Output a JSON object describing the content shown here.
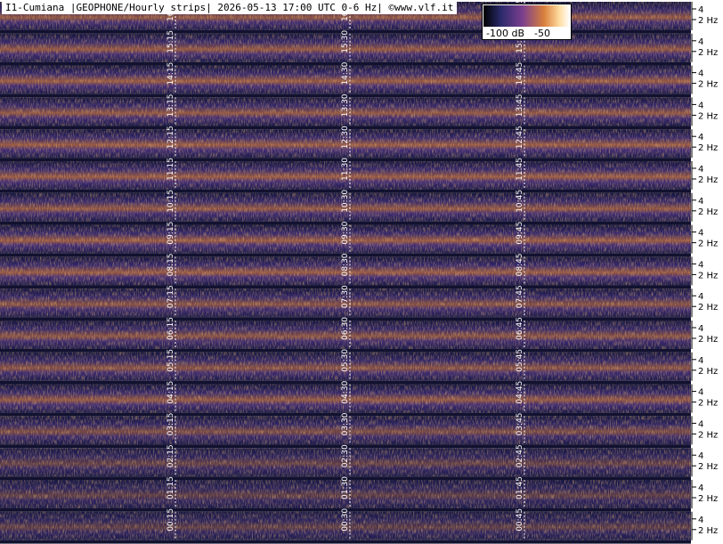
{
  "header": {
    "title": "I1-Cumiana |GEOPHONE/Hourly strips| 2026-05-13 17:00 UTC 0-6 Hz| ©www.vlf.it"
  },
  "colorbar": {
    "label_low": "-100 dB",
    "label_high": "-50"
  },
  "chart_data": {
    "type": "heatmap",
    "title": "I1-Cumiana |GEOPHONE/Hourly strips| 2026-05-13 17:00 UTC 0-6 Hz| ©www.vlf.it",
    "xlabel": "",
    "ylabel": "",
    "frequency_range_hz": [
      0,
      6
    ],
    "frequency_ticks": [
      "4",
      "2 Hz"
    ],
    "colorbar_range_db": [
      -100,
      -50
    ],
    "colormap": [
      "#000000",
      "#1a1a45",
      "#4a2f86",
      "#9a4a7e",
      "#e0883a",
      "#ffe0a0",
      "#ffffff"
    ],
    "strips": [
      {
        "hour": 16,
        "marks": [
          "16:15",
          "16:30",
          "16:45"
        ]
      },
      {
        "hour": 15,
        "marks": [
          "15:15",
          "15:30",
          "15:45"
        ]
      },
      {
        "hour": 14,
        "marks": [
          "14:15",
          "14:30",
          "14:45"
        ]
      },
      {
        "hour": 13,
        "marks": [
          "13:15",
          "13:30",
          "13:45"
        ]
      },
      {
        "hour": 12,
        "marks": [
          "12:15",
          "12:30",
          "12:45"
        ]
      },
      {
        "hour": 11,
        "marks": [
          "11:15",
          "11:30",
          "11:45"
        ]
      },
      {
        "hour": 10,
        "marks": [
          "10:15",
          "10:30",
          "10:45"
        ]
      },
      {
        "hour": 9,
        "marks": [
          "09:15",
          "09:30",
          "09:45"
        ]
      },
      {
        "hour": 8,
        "marks": [
          "08:15",
          "08:30",
          "08:45"
        ]
      },
      {
        "hour": 7,
        "marks": [
          "07:15",
          "07:30",
          "07:45"
        ]
      },
      {
        "hour": 6,
        "marks": [
          "06:15",
          "06:30",
          "06:45"
        ]
      },
      {
        "hour": 5,
        "marks": [
          "05:15",
          "05:30",
          "05:45"
        ]
      },
      {
        "hour": 4,
        "marks": [
          "04:15",
          "04:30",
          "04:45"
        ]
      },
      {
        "hour": 3,
        "marks": [
          "03:15",
          "03:30",
          "03:45"
        ]
      },
      {
        "hour": 2,
        "marks": [
          "02:15",
          "02:30",
          "02:45"
        ]
      },
      {
        "hour": 1,
        "marks": [
          "01:15",
          "01:30",
          "01:45"
        ]
      },
      {
        "hour": 0,
        "marks": [
          "00:15",
          "00:30",
          "00:45"
        ]
      }
    ],
    "strip_intensity": [
      0.75,
      0.75,
      0.8,
      0.75,
      0.8,
      0.8,
      0.75,
      0.8,
      0.8,
      0.7,
      0.7,
      0.7,
      0.75,
      0.6,
      0.45,
      0.4,
      0.4
    ],
    "grid": true
  }
}
